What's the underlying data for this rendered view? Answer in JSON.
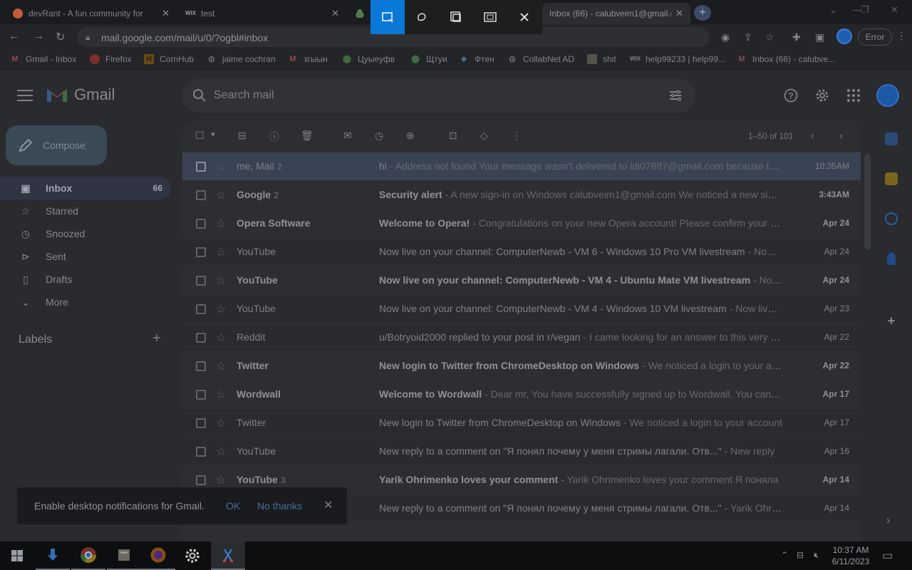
{
  "browser": {
    "tabs": [
      {
        "title": "devRant - A fun community for",
        "favicon": "rant-icon"
      },
      {
        "title": "test",
        "favicon": "wix-icon"
      },
      {
        "title": "",
        "favicon": "drive-icon"
      },
      {
        "title": "Inbox (66) - calubveim1@gmail.c",
        "favicon": "gmail-icon",
        "active": true
      }
    ],
    "url": "mail.google.com/mail/u/0/?ogbl#inbox",
    "error_button": "Error",
    "bookmarks": [
      {
        "label": "Gmail - Inbox",
        "icon": "gmail-icon"
      },
      {
        "label": "Firefox",
        "icon": "rant-icon"
      },
      {
        "label": "CornHub",
        "icon": "cornhub-icon"
      },
      {
        "label": "jaime cochran",
        "icon": "globe-icon"
      },
      {
        "label": "згыын",
        "icon": "gmail-icon"
      },
      {
        "label": "Цуыеуфв",
        "icon": "map-pin-icon"
      },
      {
        "label": "Щтуи",
        "icon": "map-pin-icon"
      },
      {
        "label": "Фтен",
        "icon": "diamond-icon"
      },
      {
        "label": "CollabNet AD",
        "icon": "globe-icon"
      },
      {
        "label": "shit",
        "icon": "image-icon"
      },
      {
        "label": "help99233 | help99...",
        "icon": "wix-icon"
      },
      {
        "label": "Inbox (66) - calubve...",
        "icon": "gmail-icon"
      }
    ]
  },
  "gmail": {
    "brand": "Gmail",
    "search_placeholder": "Search mail",
    "compose": "Compose",
    "nav": [
      {
        "label": "Inbox",
        "count": "66",
        "icon": "inbox-icon",
        "active": true
      },
      {
        "label": "Starred",
        "count": "",
        "icon": "star-icon"
      },
      {
        "label": "Snoozed",
        "count": "",
        "icon": "clock-icon"
      },
      {
        "label": "Sent",
        "count": "",
        "icon": "send-icon"
      },
      {
        "label": "Drafts",
        "count": "",
        "icon": "draft-icon"
      },
      {
        "label": "More",
        "count": "",
        "icon": "chevron-down-icon"
      }
    ],
    "labels_heading": "Labels",
    "pager": "1–50 of 101",
    "emails": [
      {
        "sender": "me, Mail",
        "count": "2",
        "subject": "hi",
        "snippet": " - Address not found Your message wasn't delivered to idi07887@gmail.com because the address couldn't be found",
        "date": "10:35AM",
        "unread": false,
        "selected": true
      },
      {
        "sender": "Google",
        "count": "2",
        "subject": "Security alert",
        "snippet": " - A new sign-in on Windows calubveim1@gmail.com We noticed a new sign-in",
        "date": "3:43AM",
        "unread": true,
        "selected": false
      },
      {
        "sender": "Opera Software",
        "count": "",
        "subject": "Welcome to Opera!",
        "snippet": " - Congratulations on your new Opera account! Please confirm your email",
        "date": "Apr 24",
        "unread": true,
        "selected": false
      },
      {
        "sender": "YouTube",
        "count": "",
        "subject": "Now live on your channel: ComputerNewb - VM 6 - Windows 10 Pro VM livestream",
        "snippet": " - Now live",
        "date": "Apr 24",
        "unread": false,
        "selected": false
      },
      {
        "sender": "YouTube",
        "count": "",
        "subject": "Now live on your channel: ComputerNewb - VM 4 - Ubuntu Mate VM livestream",
        "snippet": " - Now live",
        "date": "Apr 24",
        "unread": true,
        "selected": false
      },
      {
        "sender": "YouTube",
        "count": "",
        "subject": "Now live on your channel: ComputerNewb - VM 4 - Windows 10 VM livestream",
        "snippet": " - Now live on",
        "date": "Apr 23",
        "unread": false,
        "selected": false
      },
      {
        "sender": "Reddit",
        "count": "",
        "subject": "u/Botryoid2000 replied to your post in r/vegan",
        "snippet": " - I came looking for an answer to this very question",
        "date": "Apr 22",
        "unread": false,
        "selected": false
      },
      {
        "sender": "Twitter",
        "count": "",
        "subject": "New login to Twitter from ChromeDesktop on Windows",
        "snippet": " - We noticed a login to your account",
        "date": "Apr 22",
        "unread": true,
        "selected": false
      },
      {
        "sender": "Wordwall",
        "count": "",
        "subject": "Welcome to Wordwall",
        "snippet": " - Dear mr, You have successfully signed up to Wordwall. You can now",
        "date": "Apr 17",
        "unread": true,
        "selected": false
      },
      {
        "sender": "Twitter",
        "count": "",
        "subject": "New login to Twitter from ChromeDesktop on Windows",
        "snippet": " - We noticed a login to your account",
        "date": "Apr 17",
        "unread": false,
        "selected": false
      },
      {
        "sender": "YouTube",
        "count": "",
        "subject": "New reply to a comment on \"Я понял почему у меня стримы лагали. Отв...\"",
        "snippet": " - New reply",
        "date": "Apr 16",
        "unread": false,
        "selected": false
      },
      {
        "sender": "YouTube",
        "count": "3",
        "subject": "Yarik Ohrimenko loves your comment",
        "snippet": " - Yarik Ohrimenko loves your comment Я поняла",
        "date": "Apr 14",
        "unread": true,
        "selected": false
      },
      {
        "sender": "",
        "count": "",
        "subject": "New reply to a comment on \"Я понял почему у меня стримы лагали. Отв...\"",
        "snippet": " - Yarik Ohrimenko",
        "date": "Apr 14",
        "unread": false,
        "selected": false
      }
    ],
    "toast": {
      "message": "Enable desktop notifications for Gmail.",
      "ok": "OK",
      "no": "No thanks"
    }
  },
  "taskbar": {
    "time": "10:37 AM",
    "date": "6/11/2023"
  }
}
